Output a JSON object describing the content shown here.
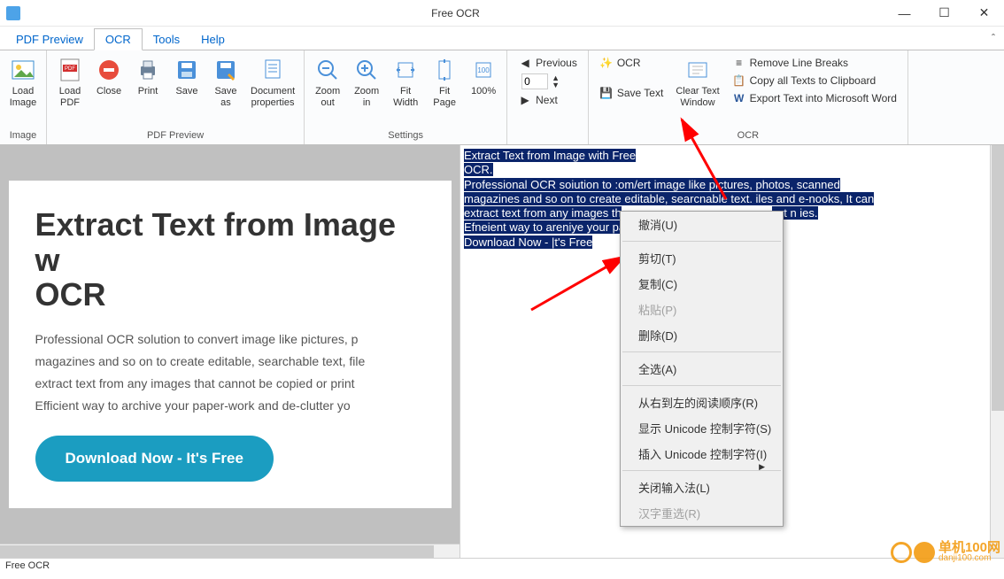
{
  "window": {
    "title": "Free OCR"
  },
  "tabs": {
    "pdf_preview": "PDF Preview",
    "ocr": "OCR",
    "tools": "Tools",
    "help": "Help"
  },
  "ribbon": {
    "image_group": {
      "title": "Image",
      "load_image": "Load\nImage"
    },
    "pdf_preview_group": {
      "title": "PDF Preview",
      "load_pdf": "Load\nPDF",
      "close": "Close",
      "print": "Print",
      "save": "Save",
      "save_as": "Save\nas",
      "doc_props": "Document\nproperties"
    },
    "settings_group": {
      "title": "Settings",
      "zoom_out": "Zoom\nout",
      "zoom_in": "Zoom\nin",
      "fit_width": "Fit\nWidth",
      "fit_page": "Fit\nPage",
      "pct": "100%"
    },
    "nav_group": {
      "previous": "Previous",
      "next": "Next",
      "page": "0"
    },
    "ocr_group": {
      "title": "OCR",
      "ocr": "OCR",
      "save_text": "Save Text",
      "clear": "Clear Text\nWindow",
      "remove_breaks": "Remove Line Breaks",
      "copy_clip": "Copy all Texts to Clipboard",
      "export_word": "Export Text into Microsoft Word"
    }
  },
  "preview_page": {
    "heading": "Extract Text from Image with Free OCR",
    "body": "Professional OCR solution to convert image like pictures, photos, scanned magazines and so on to create editable, searchable text, files and e-books. It can extract text from any images that cannot be copied or printed, next in line. Efficient way to archive your paper-work and de-clutter your desk.",
    "download": "Download Now - It's Free"
  },
  "ocr_output": {
    "line1": "Extract Text from Image with Free",
    "line2": "OCR.",
    "line3": "Professional OCR soiution to :om/ert image like pictures, photos, scanned",
    "line4": "magazines and so on to create editable, searcnable text. iles and e-nooks, It can",
    "line5": "extract text from any images that cannot be copied or printed. ext n ies.",
    "line6": "Efneient way to areniye your paper-work and de-clutter yoi",
    "line7": "Download Now - |t's Free"
  },
  "context_menu": {
    "undo": "撤消(U)",
    "cut": "剪切(T)",
    "copy": "复制(C)",
    "paste": "粘贴(P)",
    "delete": "删除(D)",
    "select_all": "全选(A)",
    "rtl": "从右到左的阅读顺序(R)",
    "show_unicode": "显示 Unicode 控制字符(S)",
    "insert_unicode": "插入 Unicode 控制字符(I)",
    "close_ime": "关闭输入法(L)",
    "hanzi": "汉字重选(R)"
  },
  "statusbar": {
    "text": "Free OCR"
  },
  "watermark": {
    "name": "单机100网",
    "url": "danji100.com"
  },
  "colors": {
    "accent": "#0066cc",
    "hilite": "#0a246a",
    "download_btn": "#1b9dc1",
    "arrow": "#ff0000"
  }
}
